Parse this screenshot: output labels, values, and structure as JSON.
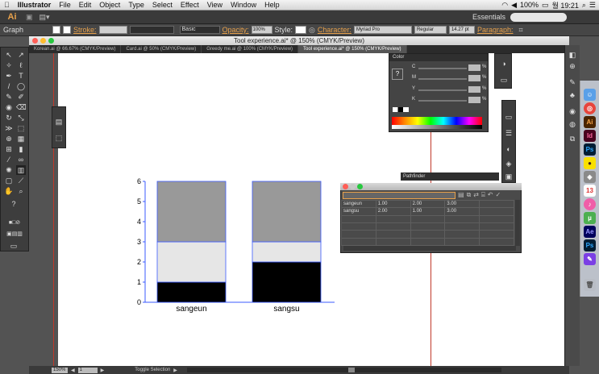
{
  "menubar": {
    "app": "Illustrator",
    "items": [
      "File",
      "Edit",
      "Object",
      "Type",
      "Select",
      "Effect",
      "View",
      "Window",
      "Help"
    ],
    "battery": "100%",
    "clock": "월 19:21"
  },
  "appbar": {
    "logo": "Ai",
    "workspace": "Essentials"
  },
  "control": {
    "selection": "Graph",
    "stroke_label": "Stroke:",
    "stroke_style": "Basic",
    "opacity_label": "Opacity:",
    "opacity_value": "100%",
    "style_label": "Style:",
    "character_label": "Character:",
    "font_family": "Myriad Pro",
    "font_style": "Regular",
    "font_size": "14.27 pt",
    "paragraph_label": "Paragraph:"
  },
  "document": {
    "title": "Tool experience.ai* @ 150% (CMYK/Preview)",
    "tabs": [
      "Korean.ai @ 66.67% (CMYK/Preview)",
      "Card.ai @ 50% (CMYK/Preview)",
      "Greedy me.ai @ 100% (CMYK/Preview)",
      "Tool experience.ai* @ 150% (CMYK/Preview)"
    ]
  },
  "color_panel": {
    "title": "Color",
    "channels": [
      "C",
      "M",
      "Y",
      "K"
    ],
    "percent_sign": "%"
  },
  "pathfinder": {
    "title": "Pathfinder"
  },
  "graph_data_window": {
    "rows": [
      {
        "label": "sangeun",
        "values": [
          "1.00",
          "2.00",
          "3.00"
        ]
      },
      {
        "label": "sangsu",
        "values": [
          "2.00",
          "1.00",
          "3.00"
        ]
      }
    ]
  },
  "statusbar": {
    "zoom": "150%",
    "page": "1",
    "status": "Toggle Selection"
  },
  "dock_apps": [
    "Ai",
    "Id",
    "Ps",
    "Ae",
    "Ps",
    "13"
  ],
  "colors": {
    "accent": "#e8a14b",
    "selection": "#3b5bff"
  },
  "chart_data": {
    "type": "bar",
    "stacked": true,
    "categories": [
      "sangeun",
      "sangsu"
    ],
    "series": [
      {
        "values": [
          1,
          2
        ],
        "color": "#000000"
      },
      {
        "values": [
          2,
          1
        ],
        "color": "#e6e6e6"
      },
      {
        "values": [
          3,
          3
        ],
        "color": "#999999"
      }
    ],
    "ylim": [
      0,
      6
    ],
    "yticks": [
      "0",
      "1",
      "2",
      "3",
      "4",
      "5",
      "6"
    ],
    "grid": false,
    "legend": "none"
  }
}
